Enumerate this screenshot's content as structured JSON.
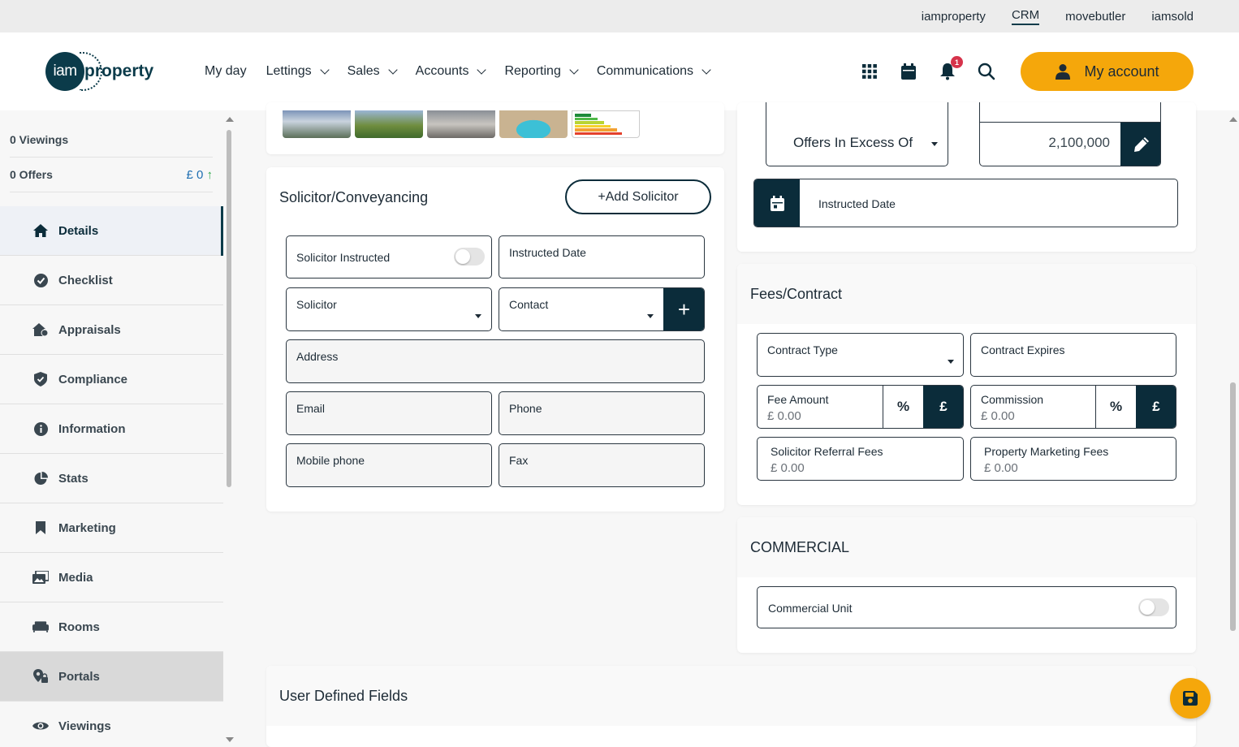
{
  "top_links": [
    "iamproperty",
    "CRM",
    "movebutler",
    "iamsold"
  ],
  "logo": {
    "circle": "iam",
    "text": "property"
  },
  "nav": {
    "my_day": "My day",
    "lettings": "Lettings",
    "sales": "Sales",
    "accounts": "Accounts",
    "reporting": "Reporting",
    "communications": "Communications"
  },
  "header": {
    "notification_count": "1",
    "account_label": "My account"
  },
  "sidebar": {
    "viewings": "0 Viewings",
    "offers": "0 Offers",
    "offers_value": "£ 0",
    "items": [
      "Details",
      "Checklist",
      "Appraisals",
      "Compliance",
      "Information",
      "Stats",
      "Marketing",
      "Media",
      "Rooms",
      "Portals",
      "Viewings"
    ]
  },
  "solicitor": {
    "title": "Solicitor/Conveyancing",
    "add_button": "+Add Solicitor",
    "solicitor_instructed": "Solicitor Instructed",
    "instructed_date": "Instructed Date",
    "solicitor": "Solicitor",
    "contact": "Contact",
    "address": "Address",
    "email": "Email",
    "phone": "Phone",
    "mobile": "Mobile phone",
    "fax": "Fax"
  },
  "price": {
    "qualifier": "Offers In Excess Of",
    "amount": "2,100,000",
    "instructed_date": "Instructed Date"
  },
  "fees": {
    "title": "Fees/Contract",
    "contract_type": "Contract Type",
    "contract_expires": "Contract Expires",
    "fee_amount": "Fee Amount",
    "fee_value": "£ 0.00",
    "commission": "Commission",
    "commission_value": "£ 0.00",
    "percent": "%",
    "pound": "£",
    "solicitor_referral": "Solicitor Referral Fees",
    "solicitor_referral_value": "£ 0.00",
    "marketing_fees": "Property Marketing Fees",
    "marketing_fees_value": "£ 0.00"
  },
  "commercial": {
    "title": "COMMERCIAL",
    "unit": "Commercial Unit"
  },
  "user_defined": {
    "title": "User Defined Fields"
  },
  "colors": {
    "brand": "#0b3b4a",
    "accent": "#f5a70b",
    "badge": "#d6334b"
  }
}
